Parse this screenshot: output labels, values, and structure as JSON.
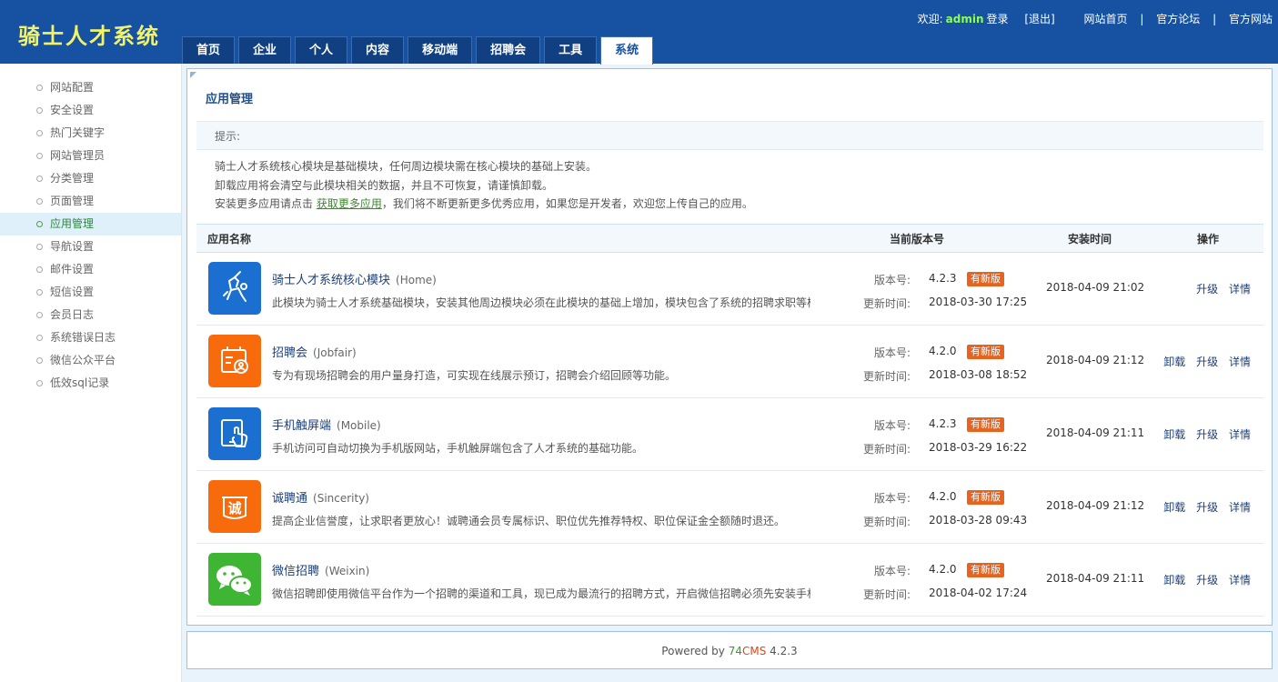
{
  "header": {
    "logo": "骑士人才系统",
    "welcome": "欢迎:",
    "username": "admin",
    "login": "登录",
    "logout": "[退出]",
    "links": [
      "网站首页",
      "官方论坛",
      "官方网站"
    ],
    "separator": "|"
  },
  "nav": {
    "tabs": [
      "首页",
      "企业",
      "个人",
      "内容",
      "移动端",
      "招聘会",
      "工具",
      "系统"
    ],
    "active": "系统"
  },
  "sidebar": {
    "items": [
      "网站配置",
      "安全设置",
      "热门关键字",
      "网站管理员",
      "分类管理",
      "页面管理",
      "应用管理",
      "导航设置",
      "邮件设置",
      "短信设置",
      "会员日志",
      "系统错误日志",
      "微信公众平台",
      "低效sql记录"
    ],
    "active": "应用管理"
  },
  "main": {
    "title": "应用管理",
    "tip_label": "提示:",
    "tip1": "骑士人才系统核心模块是基础模块，任何周边模块需在核心模块的基础上安装。",
    "tip2": "卸载应用将会清空与此模块相关的数据，并且不可恢复，请谨慎卸载。",
    "tip3_pre": "安装更多应用请点击 ",
    "tip3_link": "获取更多应用",
    "tip3_post": "，我们将不断更新更多优秀应用，如果您是开发者，欢迎您上传自己的应用。",
    "columns": {
      "name": "应用名称",
      "version": "当前版本号",
      "install_time": "安装时间",
      "ops": "操作"
    },
    "labels": {
      "version": "版本号:",
      "updated": "更新时间:",
      "new_badge": "有新版",
      "uninstall": "卸载",
      "upgrade": "升级",
      "detail": "详情"
    },
    "apps": [
      {
        "name": "骑士人才系统核心模块",
        "code": "(Home)",
        "desc": "此模块为骑士人才系统基础模块，安装其他周边模块必须在此模块的基础上增加，模块包含了系统的招聘求职等核心功能。",
        "version": "4.2.3",
        "updated": "2018-03-30 17:25",
        "installed": "2018-04-09 21:02",
        "uninstall": false,
        "icon": "knight-icon",
        "color": "#1a6fd0"
      },
      {
        "name": "招聘会",
        "code": "(Jobfair)",
        "desc": "专为有现场招聘会的用户量身打造，可实现在线展示预订，招聘会介绍回顾等功能。",
        "version": "4.2.0",
        "updated": "2018-03-08 18:52",
        "installed": "2018-04-09 21:12",
        "uninstall": true,
        "icon": "badge-icon",
        "color": "#f76b0c"
      },
      {
        "name": "手机触屏端",
        "code": "(Mobile)",
        "desc": "手机访问可自动切换为手机版网站，手机触屏端包含了人才系统的基础功能。",
        "version": "4.2.3",
        "updated": "2018-03-29 16:22",
        "installed": "2018-04-09 21:11",
        "uninstall": true,
        "icon": "tablet-touch-icon",
        "color": "#1a6fd0"
      },
      {
        "name": "诚聘通",
        "code": "(Sincerity)",
        "desc": "提高企业信誉度，让求职者更放心！诚聘通会员专属标识、职位优先推荐特权、职位保证金全额随时退还。",
        "version": "4.2.0",
        "updated": "2018-03-28 09:43",
        "installed": "2018-04-09 21:12",
        "uninstall": true,
        "icon": "sincerity-icon",
        "color": "#f76b0c"
      },
      {
        "name": "微信招聘",
        "code": "(Weixin)",
        "desc": "微信招聘即使用微信平台作为一个招聘的渠道和工具，现已成为最流行的招聘方式，开启微信招聘必须先安装手机触屏端。",
        "version": "4.2.0",
        "updated": "2018-04-02 17:24",
        "installed": "2018-04-09 21:11",
        "uninstall": true,
        "icon": "wechat-icon",
        "color": "#3fb534"
      }
    ]
  },
  "footer": {
    "powered": "Powered by",
    "brand_num": "74",
    "brand_name": "CMS",
    "version": "4.2.3"
  }
}
